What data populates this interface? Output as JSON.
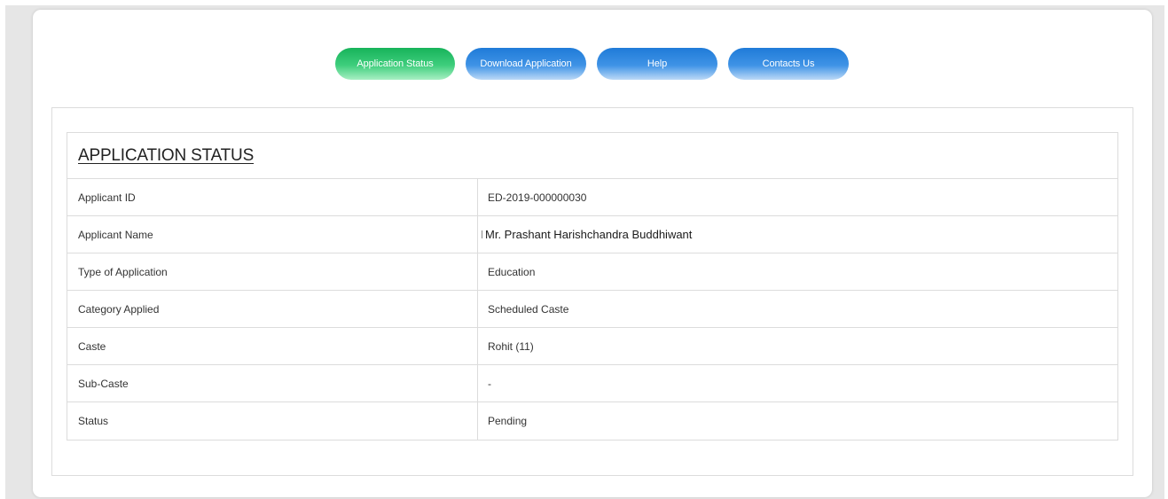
{
  "nav": {
    "buttons": [
      {
        "label": "Application Status",
        "active": true
      },
      {
        "label": "Download Application",
        "active": false
      },
      {
        "label": "Help",
        "active": false
      },
      {
        "label": "Contacts Us",
        "active": false
      }
    ]
  },
  "status": {
    "title": "APPLICATION STATUS",
    "rows": [
      {
        "label": "Applicant ID",
        "value": "ED-2019-000000030"
      },
      {
        "label": "Applicant Name",
        "value": "Mr. Prashant Harishchandra Buddhiwant"
      },
      {
        "label": "Type of Application",
        "value": "Education"
      },
      {
        "label": "Category Applied",
        "value": "Scheduled Caste"
      },
      {
        "label": "Caste",
        "value": "Rohit (11)"
      },
      {
        "label": "Sub-Caste",
        "value": "-"
      },
      {
        "label": "Status",
        "value": "Pending"
      }
    ]
  },
  "colors": {
    "active_button": "#3fce7d",
    "button": "#3f93e6",
    "border": "#dcdcdc",
    "background": "#e6e6e6"
  }
}
